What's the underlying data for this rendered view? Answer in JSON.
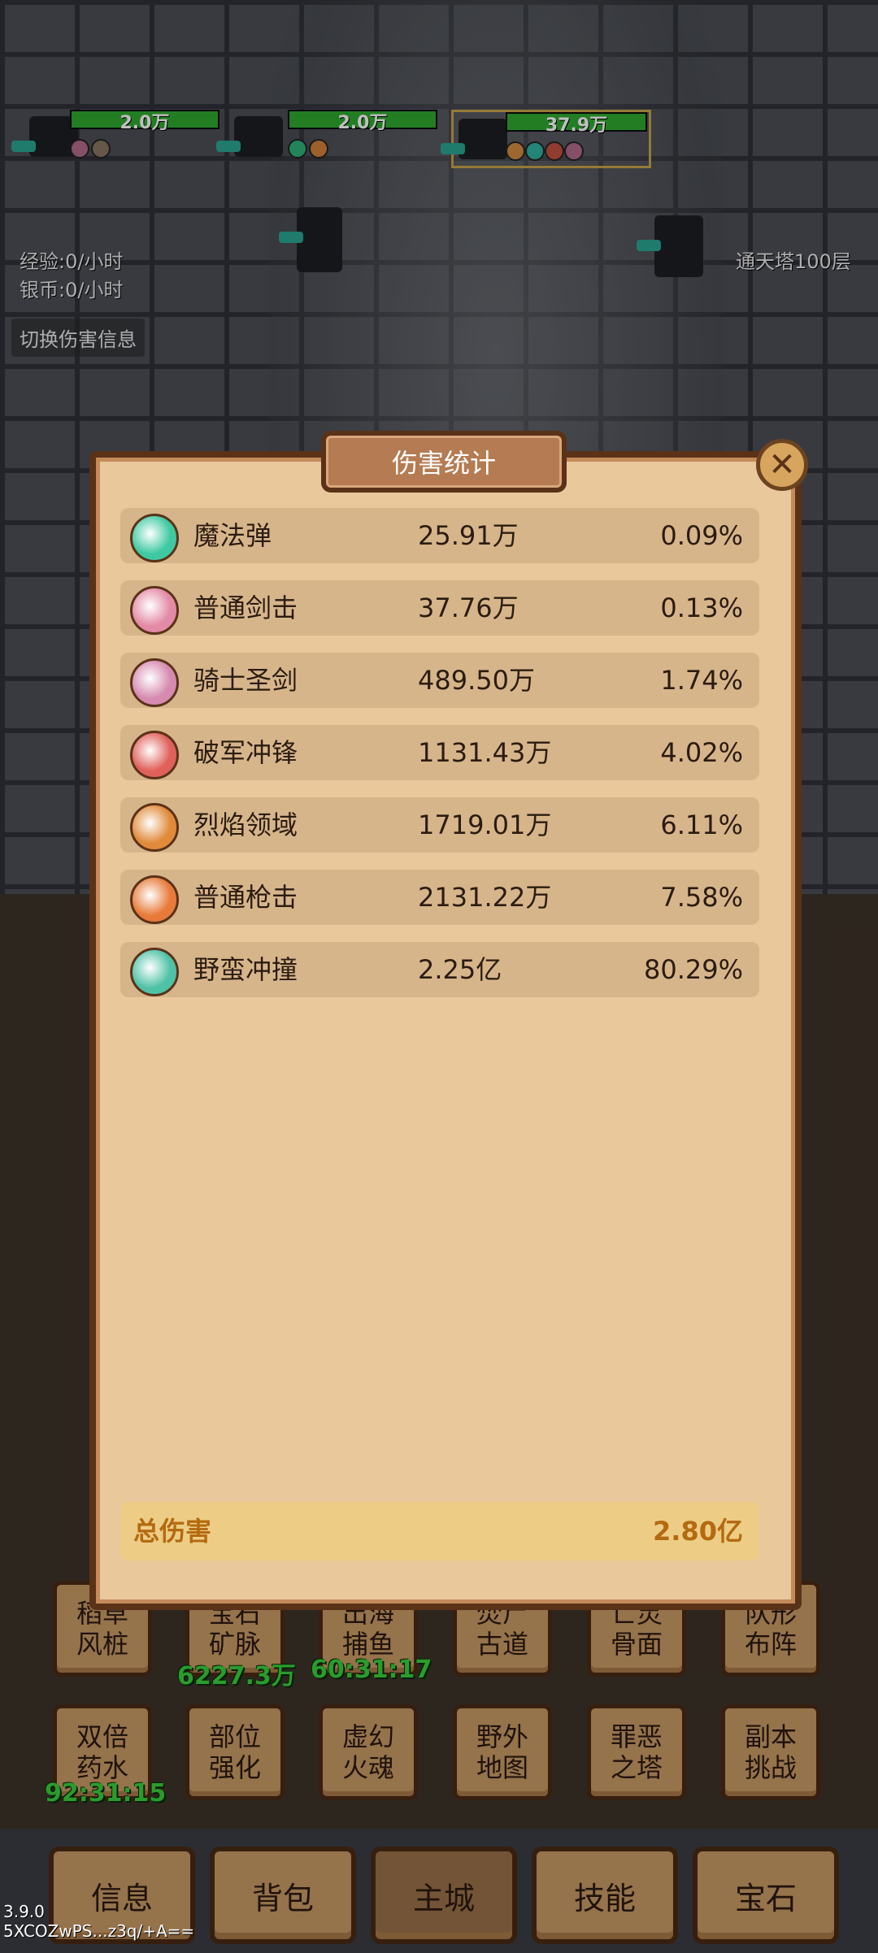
{
  "enemies": [
    {
      "hp": "2.0万",
      "hp_fraction": 1.0,
      "buffs": [
        "#b06a8a",
        "#8a7560"
      ]
    },
    {
      "hp": "2.0万",
      "hp_fraction": 1.0,
      "buffs": [
        "#2fb07a",
        "#d0803a"
      ]
    },
    {
      "hp": "37.9万",
      "hp_fraction": 1.0,
      "buffs": [
        "#d08a40",
        "#2fb0a0",
        "#c05040",
        "#b06a8a"
      ]
    }
  ],
  "side": {
    "exp_rate": "经验:0/小时",
    "silver_rate": "银币:0/小时",
    "toggle_damage": "切换伤害信息",
    "tower_floor": "通天塔100层"
  },
  "modal": {
    "title": "伤害统计",
    "rows": [
      {
        "name": "魔法弹",
        "value": "25.91万",
        "pct": "0.09%",
        "icon_color": "#3fc9a2"
      },
      {
        "name": "普通剑击",
        "value": "37.76万",
        "pct": "0.13%",
        "icon_color": "#e38aa6"
      },
      {
        "name": "骑士圣剑",
        "value": "489.50万",
        "pct": "1.74%",
        "icon_color": "#d68ab0"
      },
      {
        "name": "破军冲锋",
        "value": "1131.43万",
        "pct": "4.02%",
        "icon_color": "#e0605a"
      },
      {
        "name": "烈焰领域",
        "value": "1719.01万",
        "pct": "6.11%",
        "icon_color": "#e08a3a"
      },
      {
        "name": "普通枪击",
        "value": "2131.22万",
        "pct": "7.58%",
        "icon_color": "#e87a3a"
      },
      {
        "name": "野蛮冲撞",
        "value": "2.25亿",
        "pct": "80.29%",
        "icon_color": "#4fc2a6"
      }
    ],
    "total_label": "总伤害",
    "total_value": "2.80亿"
  },
  "grid_row1": [
    {
      "label": "稻草\n风桩"
    },
    {
      "label": "宝石\n矿脉",
      "timer": "6227.3万"
    },
    {
      "label": "出海\n捕鱼",
      "timer": "60:31:17"
    },
    {
      "label": "焚尸\n古道"
    },
    {
      "label": "亡灵\n骨面"
    },
    {
      "label": "队形\n布阵"
    }
  ],
  "grid_row2": [
    {
      "label": "双倍\n药水",
      "timer": "92:31:15"
    },
    {
      "label": "部位\n强化"
    },
    {
      "label": "虚幻\n火魂"
    },
    {
      "label": "野外\n地图"
    },
    {
      "label": "罪恶\n之塔"
    },
    {
      "label": "副本\n挑战"
    }
  ],
  "nav": [
    "信息",
    "背包",
    "主城",
    "技能",
    "宝石"
  ],
  "version": "3.9.0",
  "device_id": "5XCOZwPS...z3q/+A=="
}
